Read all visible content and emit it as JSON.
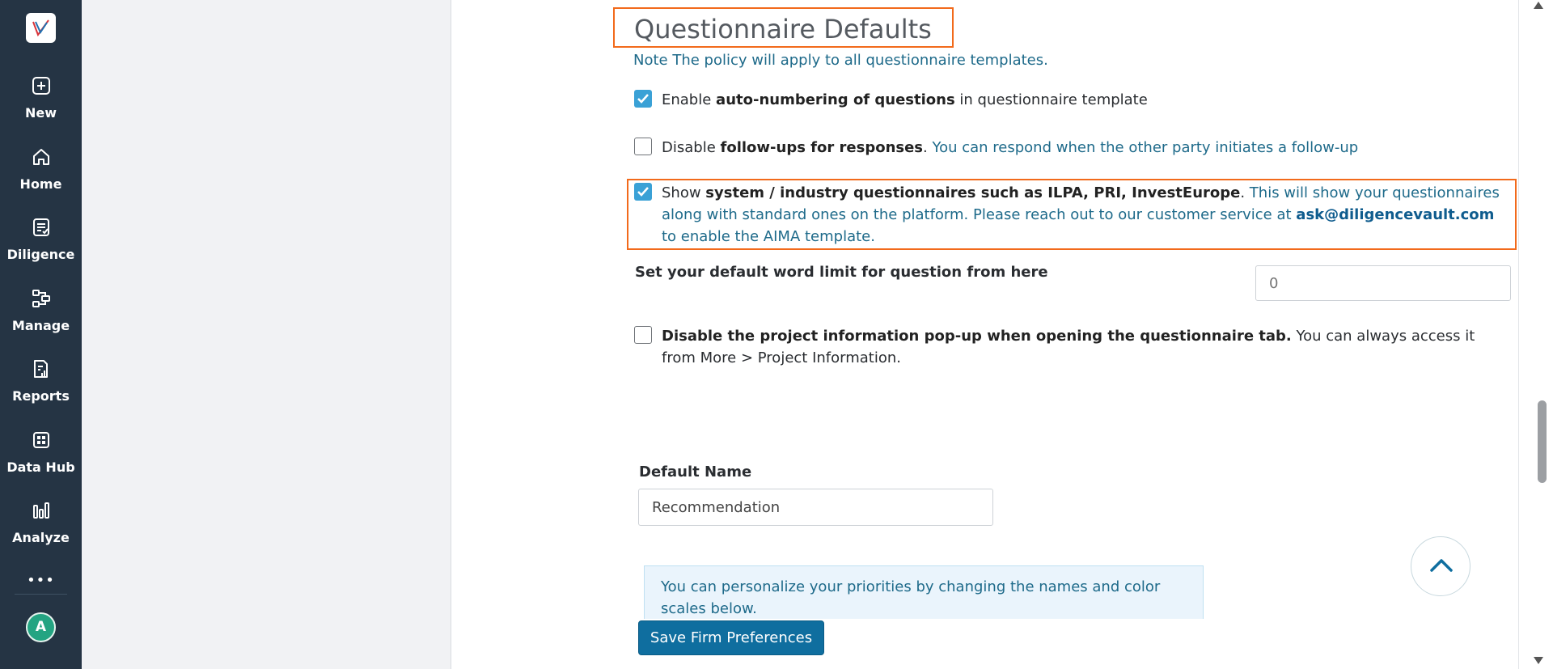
{
  "sidebar": {
    "items": [
      {
        "label": "New",
        "icon": "plus-square-icon"
      },
      {
        "label": "Home",
        "icon": "home-icon"
      },
      {
        "label": "Diligence",
        "icon": "checklist-icon"
      },
      {
        "label": "Manage",
        "icon": "workflow-icon"
      },
      {
        "label": "Reports",
        "icon": "report-icon"
      },
      {
        "label": "Data Hub",
        "icon": "grid-icon"
      },
      {
        "label": "Analyze",
        "icon": "bar-chart-icon"
      }
    ],
    "more": "•••",
    "avatar": "A"
  },
  "section": {
    "title": "Questionnaire Defaults",
    "note": "Note The policy will apply to all questionnaire templates."
  },
  "options": {
    "auto_numbering": {
      "checked": true,
      "prefix": "Enable ",
      "bold": "auto-numbering of questions",
      "suffix": " in questionnaire template"
    },
    "followups": {
      "checked": false,
      "prefix": "Disable ",
      "bold": "follow-ups for responses",
      "suffix": ".",
      "hint": " You can respond when the other party initiates a follow-up"
    },
    "system_questionnaires": {
      "checked": true,
      "prefix": "Show ",
      "bold": "system / industry questionnaires such as ILPA, PRI, InvestEurope",
      "suffix": ".",
      "hint": " This will show your questionnaires along with standard ones on the platform. Please reach out to our customer service at ",
      "email": "ask@diligencevault.com",
      "hint_end": " to enable the AIMA template."
    },
    "popup": {
      "checked": false,
      "bold": "Disable the project information pop-up when opening the questionnaire tab.",
      "rest": " You can always access it from More > Project Information."
    }
  },
  "word_limit": {
    "label": "Set your default word limit for question from here",
    "placeholder": "0"
  },
  "default_name": {
    "label": "Default Name",
    "value": "Recommendation"
  },
  "info": {
    "text": "You can personalize your priorities by changing the names and color scales below."
  },
  "save_button": "Save Firm Preferences",
  "colors": {
    "sidebar_bg": "#253444",
    "highlight": "#f26a1b",
    "checkbox": "#3aa1d6",
    "primary_button": "#0f6e9f",
    "accent_text": "#1e6a8a"
  }
}
